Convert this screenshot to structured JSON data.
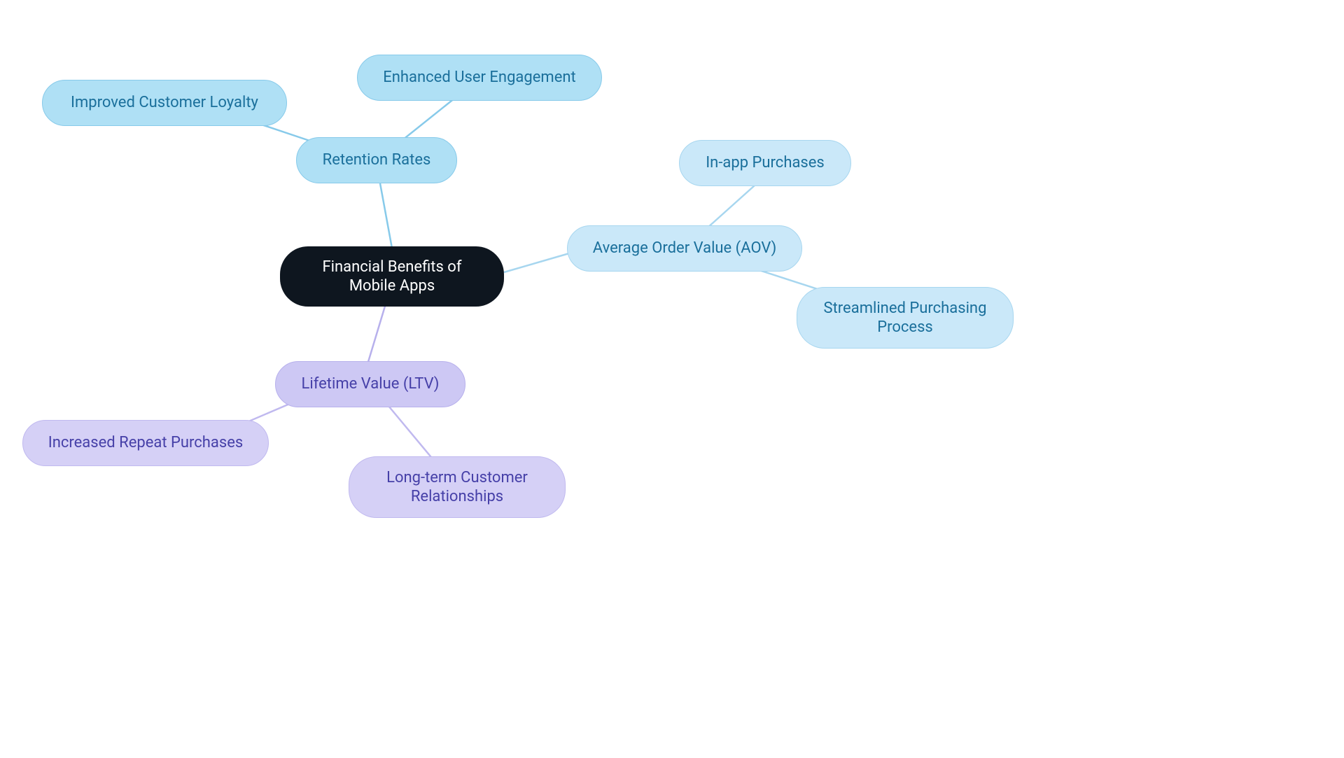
{
  "nodes": {
    "center": "Financial Benefits of Mobile Apps",
    "retention": "Retention Rates",
    "loyalty": "Improved Customer Loyalty",
    "engagement": "Enhanced User Engagement",
    "aov": "Average Order Value (AOV)",
    "inapp": "In-app Purchases",
    "streamlined": "Streamlined Purchasing Process",
    "ltv": "Lifetime Value (LTV)",
    "repeat": "Increased Repeat Purchases",
    "longterm": "Long-term Customer Relationships"
  },
  "colors": {
    "edge_blue_mid": "#87caea",
    "edge_blue_light": "#a7d6ef",
    "edge_purple_mid": "#b7b0ec",
    "edge_purple_light": "#c0b9ef"
  }
}
